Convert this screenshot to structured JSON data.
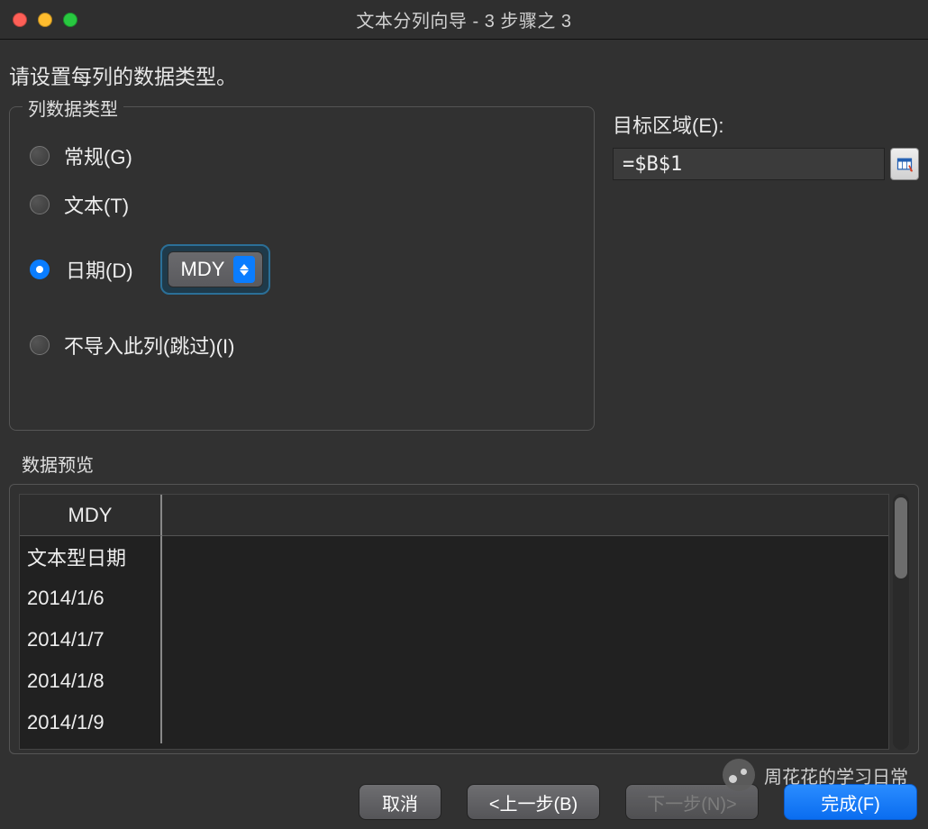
{
  "window": {
    "title": "文本分列向导 - 3 步骤之 3"
  },
  "instruction": "请设置每列的数据类型。",
  "columnType": {
    "caption": "列数据类型",
    "options": {
      "general": "常规(G)",
      "text": "文本(T)",
      "date": "日期(D)",
      "skip": "不导入此列(跳过)(I)"
    },
    "selected": "date",
    "dateFormat": "MDY"
  },
  "destination": {
    "label": "目标区域(E):",
    "value": "=$B$1"
  },
  "preview": {
    "caption": "数据预览",
    "header": "MDY",
    "rows": [
      "文本型日期",
      "2014/1/6",
      "2014/1/7",
      "2014/1/8",
      "2014/1/9"
    ]
  },
  "buttons": {
    "cancel": "取消",
    "back": "<上一步(B)",
    "next": "下一步(N)>",
    "finish": "完成(F)"
  },
  "watermark": "周花花的学习日常"
}
